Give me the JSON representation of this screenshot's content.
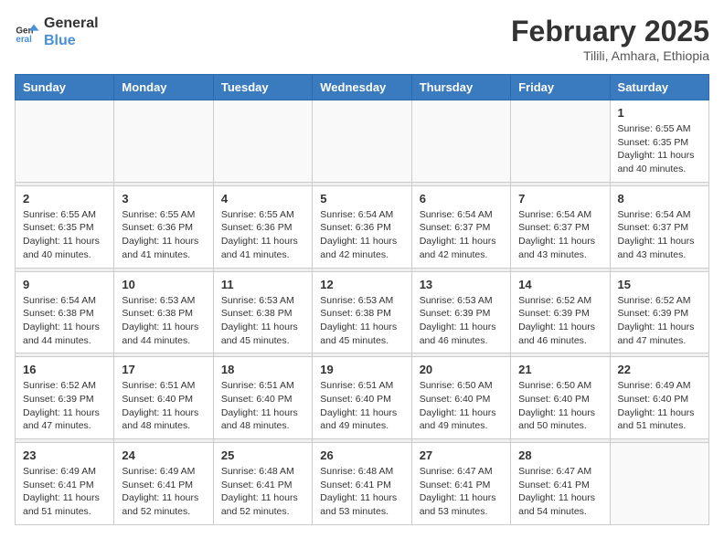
{
  "logo": {
    "line1": "General",
    "line2": "Blue"
  },
  "header": {
    "month": "February 2025",
    "location": "Tilili, Amhara, Ethiopia"
  },
  "weekdays": [
    "Sunday",
    "Monday",
    "Tuesday",
    "Wednesday",
    "Thursday",
    "Friday",
    "Saturday"
  ],
  "weeks": [
    [
      {
        "day": "",
        "info": ""
      },
      {
        "day": "",
        "info": ""
      },
      {
        "day": "",
        "info": ""
      },
      {
        "day": "",
        "info": ""
      },
      {
        "day": "",
        "info": ""
      },
      {
        "day": "",
        "info": ""
      },
      {
        "day": "1",
        "info": "Sunrise: 6:55 AM\nSunset: 6:35 PM\nDaylight: 11 hours\nand 40 minutes."
      }
    ],
    [
      {
        "day": "2",
        "info": "Sunrise: 6:55 AM\nSunset: 6:35 PM\nDaylight: 11 hours\nand 40 minutes."
      },
      {
        "day": "3",
        "info": "Sunrise: 6:55 AM\nSunset: 6:36 PM\nDaylight: 11 hours\nand 41 minutes."
      },
      {
        "day": "4",
        "info": "Sunrise: 6:55 AM\nSunset: 6:36 PM\nDaylight: 11 hours\nand 41 minutes."
      },
      {
        "day": "5",
        "info": "Sunrise: 6:54 AM\nSunset: 6:36 PM\nDaylight: 11 hours\nand 42 minutes."
      },
      {
        "day": "6",
        "info": "Sunrise: 6:54 AM\nSunset: 6:37 PM\nDaylight: 11 hours\nand 42 minutes."
      },
      {
        "day": "7",
        "info": "Sunrise: 6:54 AM\nSunset: 6:37 PM\nDaylight: 11 hours\nand 43 minutes."
      },
      {
        "day": "8",
        "info": "Sunrise: 6:54 AM\nSunset: 6:37 PM\nDaylight: 11 hours\nand 43 minutes."
      }
    ],
    [
      {
        "day": "9",
        "info": "Sunrise: 6:54 AM\nSunset: 6:38 PM\nDaylight: 11 hours\nand 44 minutes."
      },
      {
        "day": "10",
        "info": "Sunrise: 6:53 AM\nSunset: 6:38 PM\nDaylight: 11 hours\nand 44 minutes."
      },
      {
        "day": "11",
        "info": "Sunrise: 6:53 AM\nSunset: 6:38 PM\nDaylight: 11 hours\nand 45 minutes."
      },
      {
        "day": "12",
        "info": "Sunrise: 6:53 AM\nSunset: 6:38 PM\nDaylight: 11 hours\nand 45 minutes."
      },
      {
        "day": "13",
        "info": "Sunrise: 6:53 AM\nSunset: 6:39 PM\nDaylight: 11 hours\nand 46 minutes."
      },
      {
        "day": "14",
        "info": "Sunrise: 6:52 AM\nSunset: 6:39 PM\nDaylight: 11 hours\nand 46 minutes."
      },
      {
        "day": "15",
        "info": "Sunrise: 6:52 AM\nSunset: 6:39 PM\nDaylight: 11 hours\nand 47 minutes."
      }
    ],
    [
      {
        "day": "16",
        "info": "Sunrise: 6:52 AM\nSunset: 6:39 PM\nDaylight: 11 hours\nand 47 minutes."
      },
      {
        "day": "17",
        "info": "Sunrise: 6:51 AM\nSunset: 6:40 PM\nDaylight: 11 hours\nand 48 minutes."
      },
      {
        "day": "18",
        "info": "Sunrise: 6:51 AM\nSunset: 6:40 PM\nDaylight: 11 hours\nand 48 minutes."
      },
      {
        "day": "19",
        "info": "Sunrise: 6:51 AM\nSunset: 6:40 PM\nDaylight: 11 hours\nand 49 minutes."
      },
      {
        "day": "20",
        "info": "Sunrise: 6:50 AM\nSunset: 6:40 PM\nDaylight: 11 hours\nand 49 minutes."
      },
      {
        "day": "21",
        "info": "Sunrise: 6:50 AM\nSunset: 6:40 PM\nDaylight: 11 hours\nand 50 minutes."
      },
      {
        "day": "22",
        "info": "Sunrise: 6:49 AM\nSunset: 6:40 PM\nDaylight: 11 hours\nand 51 minutes."
      }
    ],
    [
      {
        "day": "23",
        "info": "Sunrise: 6:49 AM\nSunset: 6:41 PM\nDaylight: 11 hours\nand 51 minutes."
      },
      {
        "day": "24",
        "info": "Sunrise: 6:49 AM\nSunset: 6:41 PM\nDaylight: 11 hours\nand 52 minutes."
      },
      {
        "day": "25",
        "info": "Sunrise: 6:48 AM\nSunset: 6:41 PM\nDaylight: 11 hours\nand 52 minutes."
      },
      {
        "day": "26",
        "info": "Sunrise: 6:48 AM\nSunset: 6:41 PM\nDaylight: 11 hours\nand 53 minutes."
      },
      {
        "day": "27",
        "info": "Sunrise: 6:47 AM\nSunset: 6:41 PM\nDaylight: 11 hours\nand 53 minutes."
      },
      {
        "day": "28",
        "info": "Sunrise: 6:47 AM\nSunset: 6:41 PM\nDaylight: 11 hours\nand 54 minutes."
      },
      {
        "day": "",
        "info": ""
      }
    ]
  ]
}
